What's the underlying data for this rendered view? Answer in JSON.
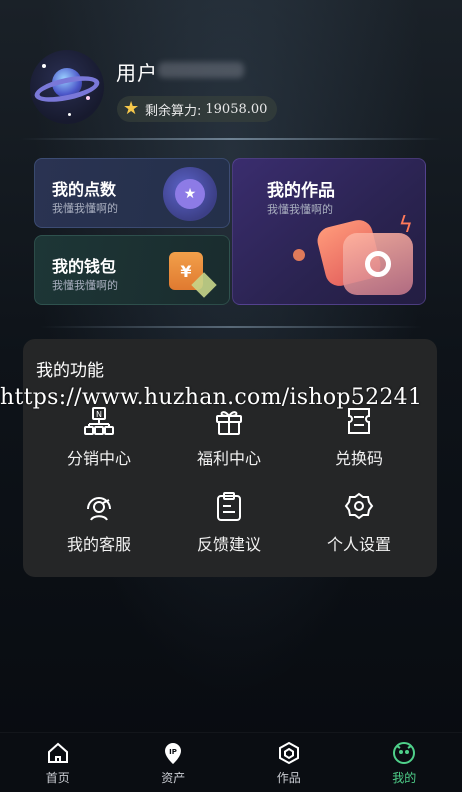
{
  "header": {
    "username": "用户",
    "compute_label": "剩余算力:",
    "compute_value": "19058.00"
  },
  "cards": {
    "points": {
      "title": "我的点数",
      "subtitle": "我懂我懂啊的"
    },
    "wallet": {
      "title": "我的钱包",
      "subtitle": "我懂我懂啊的",
      "icon_symbol": "¥"
    },
    "works": {
      "title": "我的作品",
      "subtitle": "我懂我懂啊的"
    }
  },
  "functions": {
    "title": "我的功能",
    "items": [
      {
        "label": "分销中心",
        "icon": "distribution-icon"
      },
      {
        "label": "福利中心",
        "icon": "gift-icon"
      },
      {
        "label": "兑换码",
        "icon": "ticket-icon"
      },
      {
        "label": "我的客服",
        "icon": "customer-service-icon"
      },
      {
        "label": "反馈建议",
        "icon": "clipboard-icon"
      },
      {
        "label": "个人设置",
        "icon": "settings-gear-icon"
      }
    ]
  },
  "watermark": "https://www.huzhan.com/ishop52241",
  "tabbar": {
    "tabs": [
      {
        "label": "首页",
        "icon": "home-icon",
        "active": false
      },
      {
        "label": "资产",
        "icon": "ip-pin-icon",
        "active": false
      },
      {
        "label": "作品",
        "icon": "hexagon-icon",
        "active": false
      },
      {
        "label": "我的",
        "icon": "smile-face-icon",
        "active": true
      }
    ]
  },
  "colors": {
    "accent_active_tab": "#4fd08a",
    "panel_bg": "#252627",
    "star_gold": "#f6c84b"
  }
}
